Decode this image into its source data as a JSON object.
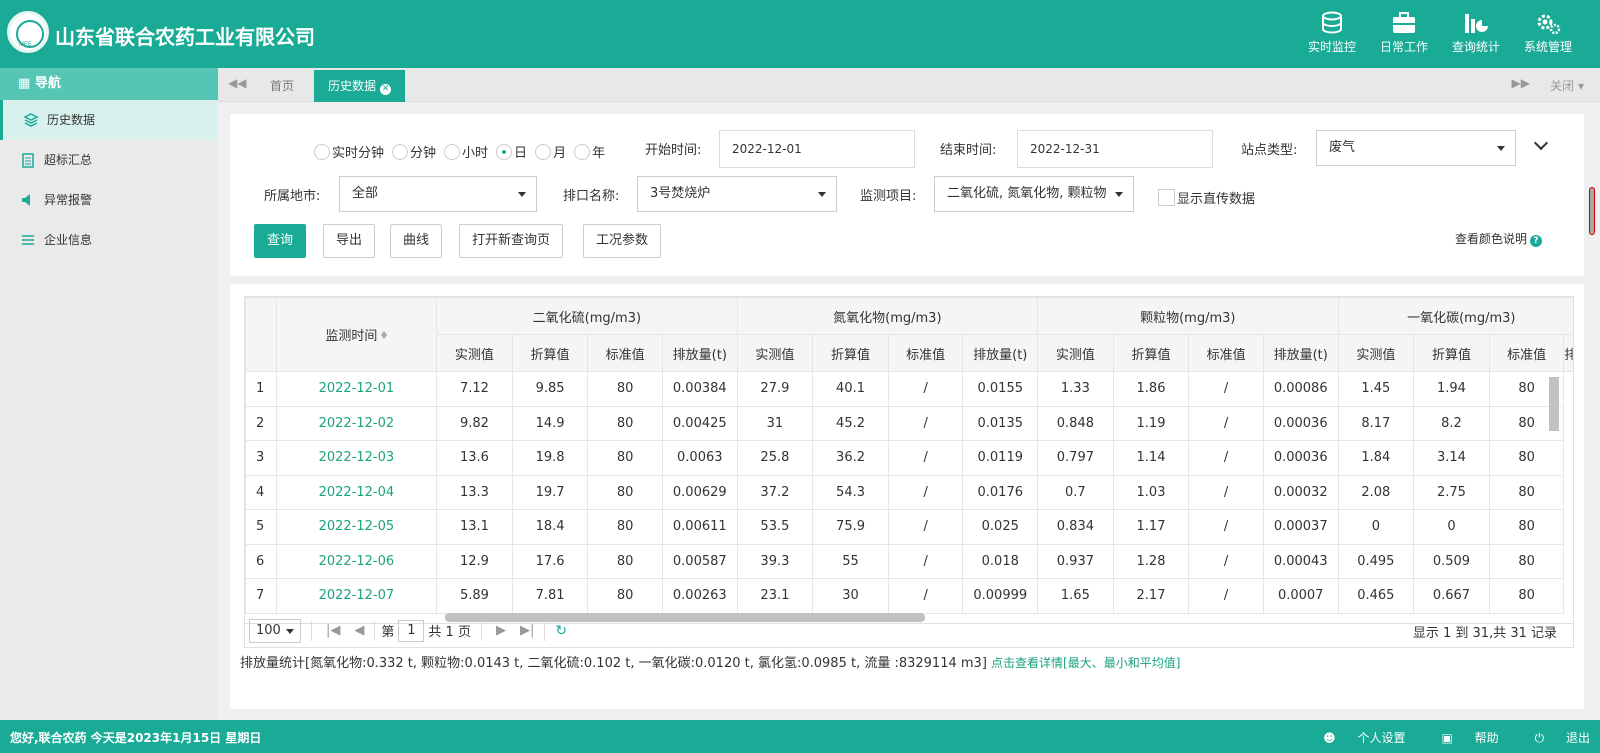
{
  "header": {
    "title": "山东省联合农药工业有限公司",
    "nav": [
      {
        "label": "实时监控",
        "icon": "database-icon"
      },
      {
        "label": "日常工作",
        "icon": "briefcase-icon"
      },
      {
        "label": "查询统计",
        "icon": "chart-icon"
      },
      {
        "label": "系统管理",
        "icon": "gear-icon"
      }
    ]
  },
  "sidebar": {
    "heading": "导航",
    "items": [
      {
        "label": "历史数据",
        "icon": "layers-icon"
      },
      {
        "label": "超标汇总",
        "icon": "clipboard-icon"
      },
      {
        "label": "异常报警",
        "icon": "speaker-icon"
      },
      {
        "label": "企业信息",
        "icon": "list-icon"
      }
    ]
  },
  "tabs": {
    "home": "首页",
    "active": "历史数据",
    "close": "关闭"
  },
  "filter": {
    "radios": [
      "实时分钟",
      "分钟",
      "小时",
      "日",
      "月",
      "年"
    ],
    "selected_radio": "日",
    "start_label": "开始时间:",
    "start_value": "2022-12-01",
    "end_label": "结束时间:",
    "end_value": "2022-12-31",
    "site_type_label": "站点类型:",
    "site_type_value": "废气",
    "city_label": "所属地市:",
    "city_value": "全部",
    "outlet_label": "排口名称:",
    "outlet_value": "3号焚烧炉",
    "item_label": "监测项目:",
    "item_value": "二氧化硫, 氮氧化物, 颗粒物",
    "direct_label": "显示直传数据",
    "buttons": {
      "query": "查询",
      "export": "导出",
      "curve": "曲线",
      "open_new": "打开新查询页",
      "params": "工况参数"
    },
    "color_help": "查看颜色说明"
  },
  "table": {
    "time_header": "监测时间",
    "groups": [
      "二氧化硫(mg/m3)",
      "氮氧化物(mg/m3)",
      "颗粒物(mg/m3)",
      "一氧化碳(mg/m3)"
    ],
    "subheaders": [
      "实测值",
      "折算值",
      "标准值",
      "排放量(t)"
    ],
    "rows": [
      {
        "idx": "1",
        "date": "2022-12-01",
        "vals": [
          "7.12",
          "9.85",
          "80",
          "0.00384",
          "27.9",
          "40.1",
          "/",
          "0.0155",
          "1.33",
          "1.86",
          "/",
          "0.00086",
          "1.45",
          "1.94",
          "80"
        ]
      },
      {
        "idx": "2",
        "date": "2022-12-02",
        "vals": [
          "9.82",
          "14.9",
          "80",
          "0.00425",
          "31",
          "45.2",
          "/",
          "0.0135",
          "0.848",
          "1.19",
          "/",
          "0.00036",
          "8.17",
          "8.2",
          "80"
        ]
      },
      {
        "idx": "3",
        "date": "2022-12-03",
        "vals": [
          "13.6",
          "19.8",
          "80",
          "0.0063",
          "25.8",
          "36.2",
          "/",
          "0.0119",
          "0.797",
          "1.14",
          "/",
          "0.00036",
          "1.84",
          "3.14",
          "80"
        ]
      },
      {
        "idx": "4",
        "date": "2022-12-04",
        "vals": [
          "13.3",
          "19.7",
          "80",
          "0.00629",
          "37.2",
          "54.3",
          "/",
          "0.0176",
          "0.7",
          "1.03",
          "/",
          "0.00032",
          "2.08",
          "2.75",
          "80"
        ]
      },
      {
        "idx": "5",
        "date": "2022-12-05",
        "vals": [
          "13.1",
          "18.4",
          "80",
          "0.00611",
          "53.5",
          "75.9",
          "/",
          "0.025",
          "0.834",
          "1.17",
          "/",
          "0.00037",
          "0",
          "0",
          "80"
        ]
      },
      {
        "idx": "6",
        "date": "2022-12-06",
        "vals": [
          "12.9",
          "17.6",
          "80",
          "0.00587",
          "39.3",
          "55",
          "/",
          "0.018",
          "0.937",
          "1.28",
          "/",
          "0.00043",
          "0.495",
          "0.509",
          "80"
        ]
      },
      {
        "idx": "7",
        "date": "2022-12-07",
        "vals": [
          "5.89",
          "7.81",
          "80",
          "0.00263",
          "23.1",
          "30",
          "/",
          "0.00999",
          "1.65",
          "2.17",
          "/",
          "0.0007",
          "0.465",
          "0.667",
          "80"
        ]
      }
    ]
  },
  "pager": {
    "page_size": "100",
    "page_prefix": "第",
    "page_value": "1",
    "page_suffix": "共 1 页",
    "summary": "显示 1 到 31,共 31 记录"
  },
  "stats": {
    "text": "排放量统计[氮氧化物:0.332 t, 颗粒物:0.0143 t, 二氧化硫:0.102 t, 一氧化碳:0.0120 t, 氯化氢:0.0985 t, 流量 :8329114 m3]",
    "link": "点击查看详情[最大、最小和平均值]"
  },
  "footer": {
    "greeting": "您好,联合农药 今天是2023年1月15日 星期日",
    "links": [
      "个人设置",
      "帮助",
      "退出"
    ]
  }
}
